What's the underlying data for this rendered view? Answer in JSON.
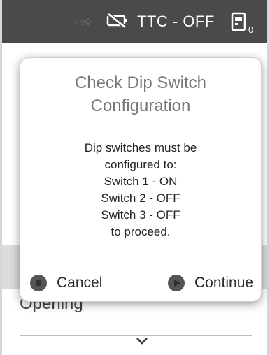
{
  "header": {
    "brand": "myQ",
    "battery_icon": "battery-disconnected-icon",
    "status_label": "TTC - OFF",
    "remote_icon": "remote-icon",
    "remote_count": "0"
  },
  "background": {
    "opening_label": "Opening"
  },
  "dialog": {
    "title_line1": "Check Dip Switch",
    "title_line2": "Configuration",
    "body_lines": [
      "Dip switches must be",
      "configured to:",
      "Switch 1 - ON",
      "Switch 2 - OFF",
      "Switch 3 - OFF",
      "to proceed."
    ],
    "cancel_label": "Cancel",
    "continue_label": "Continue"
  },
  "colors": {
    "topbar": "#4a4a4a",
    "dialog_title": "#777777",
    "button_icon": "#555555"
  }
}
